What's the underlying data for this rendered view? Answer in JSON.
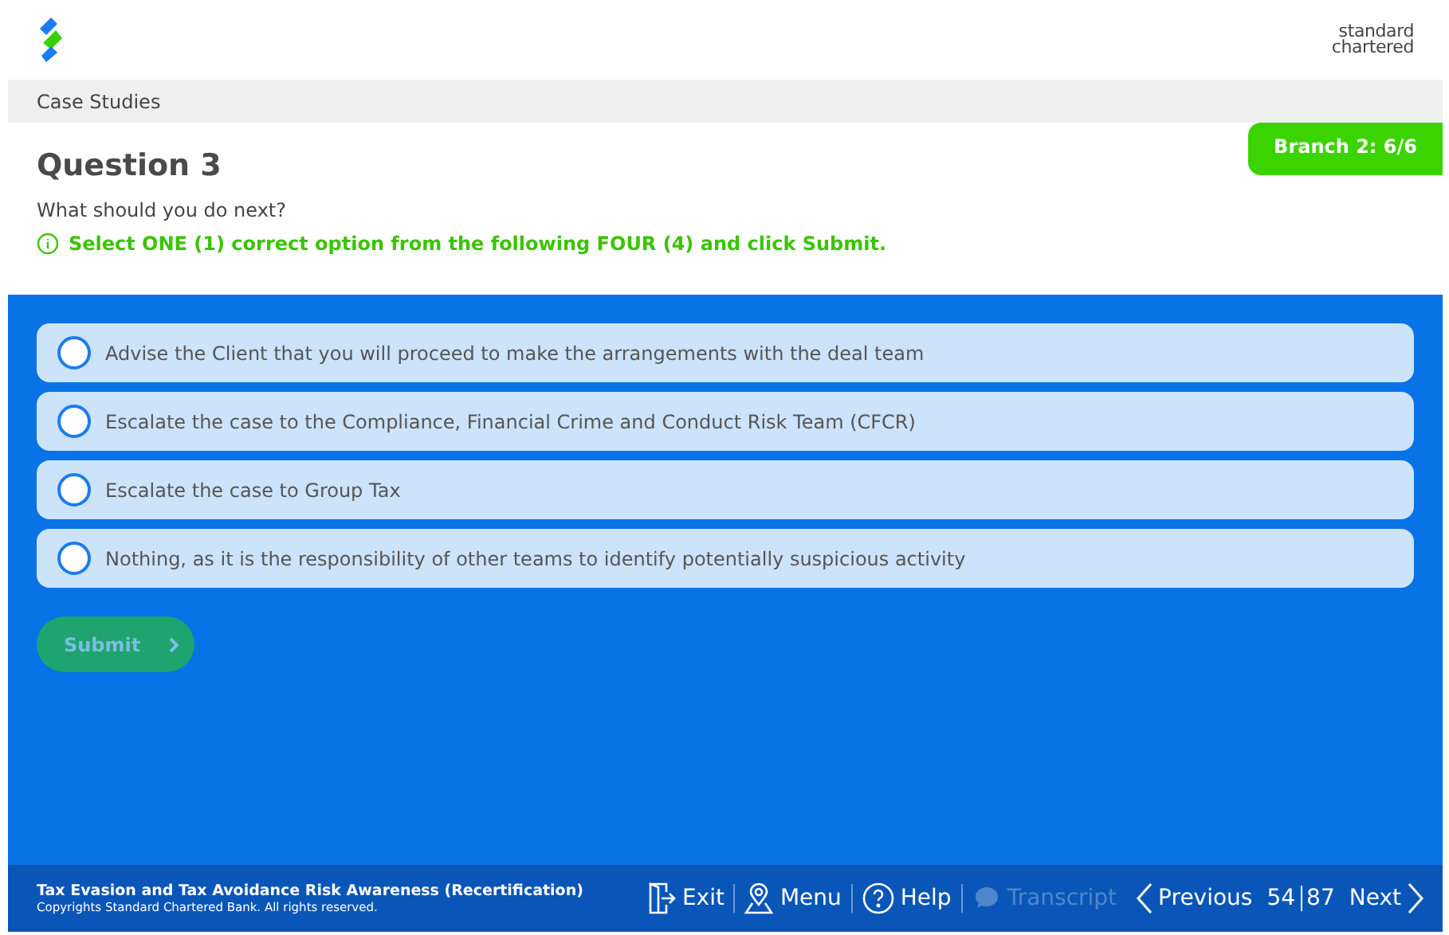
{
  "brand": {
    "lines": [
      "standard",
      "chartered"
    ]
  },
  "breadcrumb": "Case Studies",
  "branch_badge": "Branch 2: 6/6",
  "question": {
    "title": "Question 3",
    "prompt": "What should you do next?",
    "instruction": "Select ONE (1) correct option from the following FOUR (4) and click Submit."
  },
  "options": [
    {
      "label": "Advise the Client that you will proceed to make the arrangements with the deal team",
      "selected": false
    },
    {
      "label": "Escalate the case to the Compliance, Financial Crime and Conduct Risk Team (CFCR)",
      "selected": false
    },
    {
      "label": "Escalate the case to Group Tax",
      "selected": false
    },
    {
      "label": "Nothing, as it is the responsibility of other teams to identify potentially suspicious activity",
      "selected": false
    }
  ],
  "submit": {
    "label": "Submit",
    "disabled": true
  },
  "footer": {
    "course_title": "Tax Evasion and Tax Avoidance Risk Awareness (Recertification)",
    "copyright": "Copyrights Standard Chartered Bank. All rights reserved.",
    "nav": [
      {
        "kind": "exit",
        "label": "Exit",
        "disabled": false
      },
      {
        "kind": "menu",
        "label": "Menu",
        "disabled": false
      },
      {
        "kind": "help",
        "label": "Help",
        "disabled": false
      },
      {
        "kind": "transcript",
        "label": "Transcript",
        "disabled": true
      }
    ],
    "previous": "Previous",
    "page_current": "54",
    "page_total": "87",
    "next": "Next"
  }
}
